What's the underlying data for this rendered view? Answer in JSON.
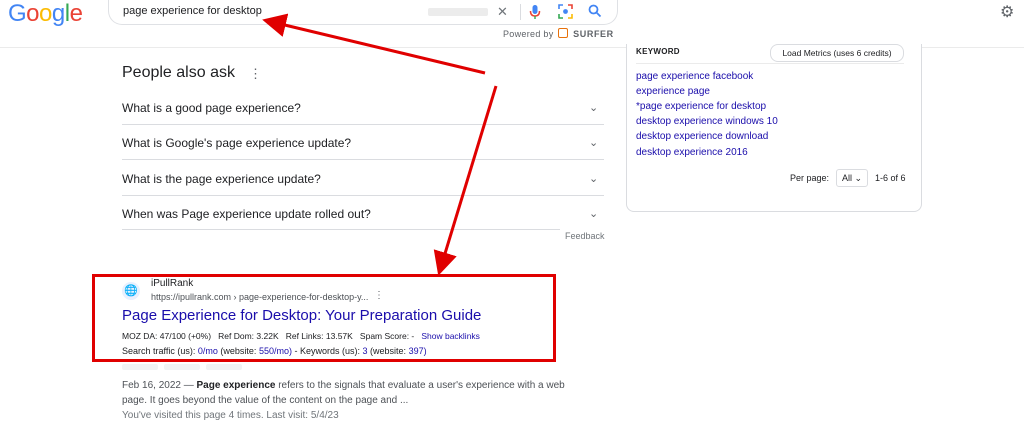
{
  "header": {
    "logo": [
      {
        "ch": "G",
        "color": "#4285F4"
      },
      {
        "ch": "o",
        "color": "#EA4335"
      },
      {
        "ch": "o",
        "color": "#FBBC05"
      },
      {
        "ch": "g",
        "color": "#4285F4"
      },
      {
        "ch": "l",
        "color": "#34A853"
      },
      {
        "ch": "e",
        "color": "#EA4335"
      }
    ],
    "search_query": "page experience for desktop",
    "powered_by": "Powered by",
    "surfer": "SURFER"
  },
  "paa": {
    "title": "People also ask",
    "questions": [
      "What is a good page experience?",
      "What is Google's page experience update?",
      "What is the page experience update?",
      "When was Page experience update rolled out?"
    ],
    "feedback": "Feedback"
  },
  "result": {
    "site_name": "iPullRank",
    "url": "https://ipullrank.com › page-experience-for-desktop-y...",
    "title": "Page Experience for Desktop: Your Preparation Guide",
    "metrics": {
      "moz_da": "MOZ DA: 47/100 (+0%)",
      "ref_dom": "Ref Dom: 3.22K",
      "ref_links": "Ref Links: 13.57K",
      "spam": "Spam Score: -",
      "show_backlinks": "Show backlinks"
    },
    "traffic": {
      "prefix": "Search traffic (us):",
      "monthly": "0/mo",
      "website_open": "(website:",
      "website_val": "550/mo)",
      "kw_prefix": "- Keywords (us):",
      "kw_val": "3",
      "kw_site_open": "(website:",
      "kw_site_val": "397)"
    },
    "date": "Feb 16, 2022",
    "snippet_bold": "Page experience",
    "snippet_rest": " refers to the signals that evaluate a user's experience with a web page. It goes beyond the value of the content on the page and ...",
    "visited": "You've visited this page 4 times. Last visit: 5/4/23"
  },
  "panel": {
    "keyword_header": "KEYWORD",
    "load_button": "Load Metrics (uses 6 credits)",
    "keywords": [
      "page experience facebook",
      "experience page",
      "*page experience for desktop",
      "desktop experience windows 10",
      "desktop experience download",
      "desktop experience 2016"
    ],
    "per_page_label": "Per page:",
    "per_page_value": "All",
    "range": "1-6 of 6"
  },
  "colors": {
    "annotation": "#e00000",
    "link": "#1a0dab"
  },
  "icons": [
    "clear-icon",
    "mic-icon",
    "lens-icon",
    "search-icon",
    "gear-icon",
    "globe-icon",
    "kebab-icon",
    "chevron-down-icon"
  ]
}
